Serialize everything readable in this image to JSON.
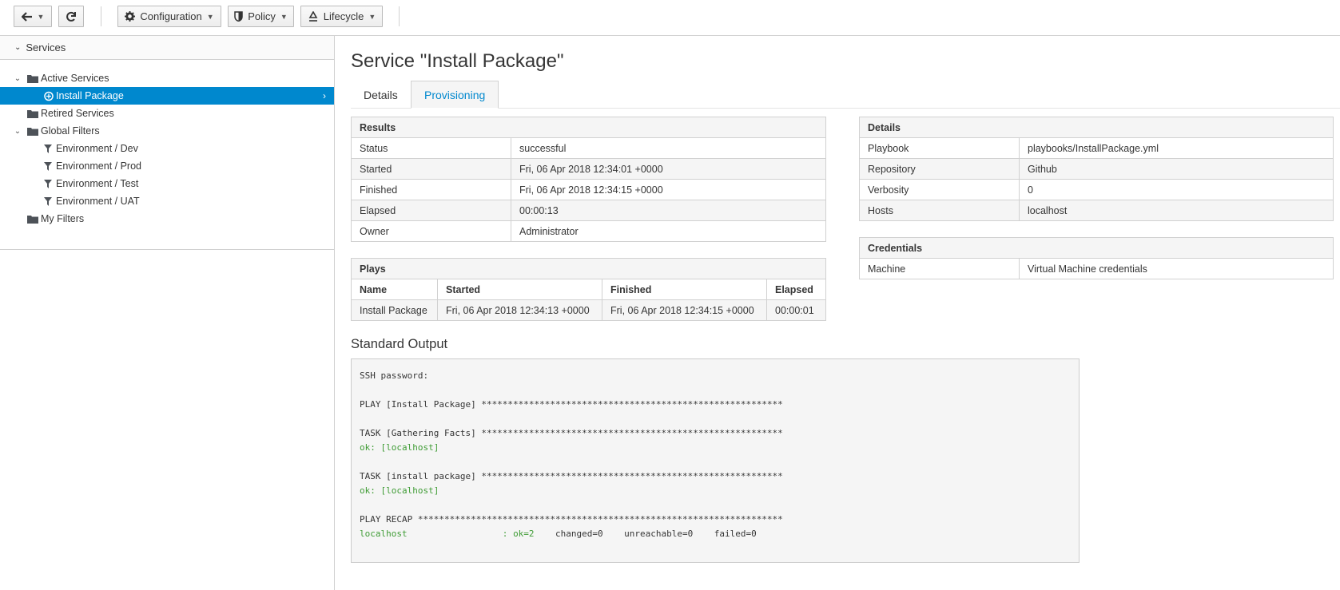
{
  "toolbar": {
    "back_icon": "arrow-left-icon",
    "reload_icon": "refresh-icon",
    "configuration_label": "Configuration",
    "policy_label": "Policy",
    "lifecycle_label": "Lifecycle"
  },
  "sidebar": {
    "header": "Services",
    "tree": {
      "active_services": "Active Services",
      "install_package": "Install Package",
      "retired_services": "Retired Services",
      "global_filters": "Global Filters",
      "env_dev": "Environment / Dev",
      "env_prod": "Environment / Prod",
      "env_test": "Environment / Test",
      "env_uat": "Environment / UAT",
      "my_filters": "My Filters"
    }
  },
  "main": {
    "title": "Service \"Install Package\"",
    "tabs": [
      "Details",
      "Provisioning"
    ],
    "active_tab": "Provisioning",
    "results": {
      "caption": "Results",
      "rows": [
        {
          "label": "Status",
          "value": "successful"
        },
        {
          "label": "Started",
          "value": "Fri, 06 Apr 2018 12:34:01 +0000"
        },
        {
          "label": "Finished",
          "value": "Fri, 06 Apr 2018 12:34:15 +0000"
        },
        {
          "label": "Elapsed",
          "value": "00:00:13"
        },
        {
          "label": "Owner",
          "value": "Administrator"
        }
      ]
    },
    "plays": {
      "caption": "Plays",
      "headers": [
        "Name",
        "Started",
        "Finished",
        "Elapsed"
      ],
      "rows": [
        [
          "Install Package",
          "Fri, 06 Apr 2018 12:34:13 +0000",
          "Fri, 06 Apr 2018 12:34:15 +0000",
          "00:00:01"
        ]
      ]
    },
    "details": {
      "caption": "Details",
      "rows": [
        {
          "label": "Playbook",
          "value": "playbooks/InstallPackage.yml"
        },
        {
          "label": "Repository",
          "value": "Github"
        },
        {
          "label": "Verbosity",
          "value": "0"
        },
        {
          "label": "Hosts",
          "value": "localhost"
        }
      ]
    },
    "credentials": {
      "caption": "Credentials",
      "rows": [
        {
          "label": "Machine",
          "value": "Virtual Machine credentials"
        }
      ]
    },
    "standard_output": {
      "title": "Standard Output",
      "l1": "SSH password:",
      "l2": "PLAY [Install Package] *********************************************************",
      "l3": "TASK [Gathering Facts] *********************************************************",
      "l4": "ok: [localhost]",
      "l5": "TASK [install package] *********************************************************",
      "l6": "ok: [localhost]",
      "l7": "PLAY RECAP *********************************************************************",
      "recap_host": "localhost                  : ",
      "recap_ok": "ok=2",
      "recap_rest": "    changed=0    unreachable=0    failed=0"
    },
    "colors": {
      "accent": "#0088ce",
      "ok_green": "#3f9c35"
    }
  }
}
